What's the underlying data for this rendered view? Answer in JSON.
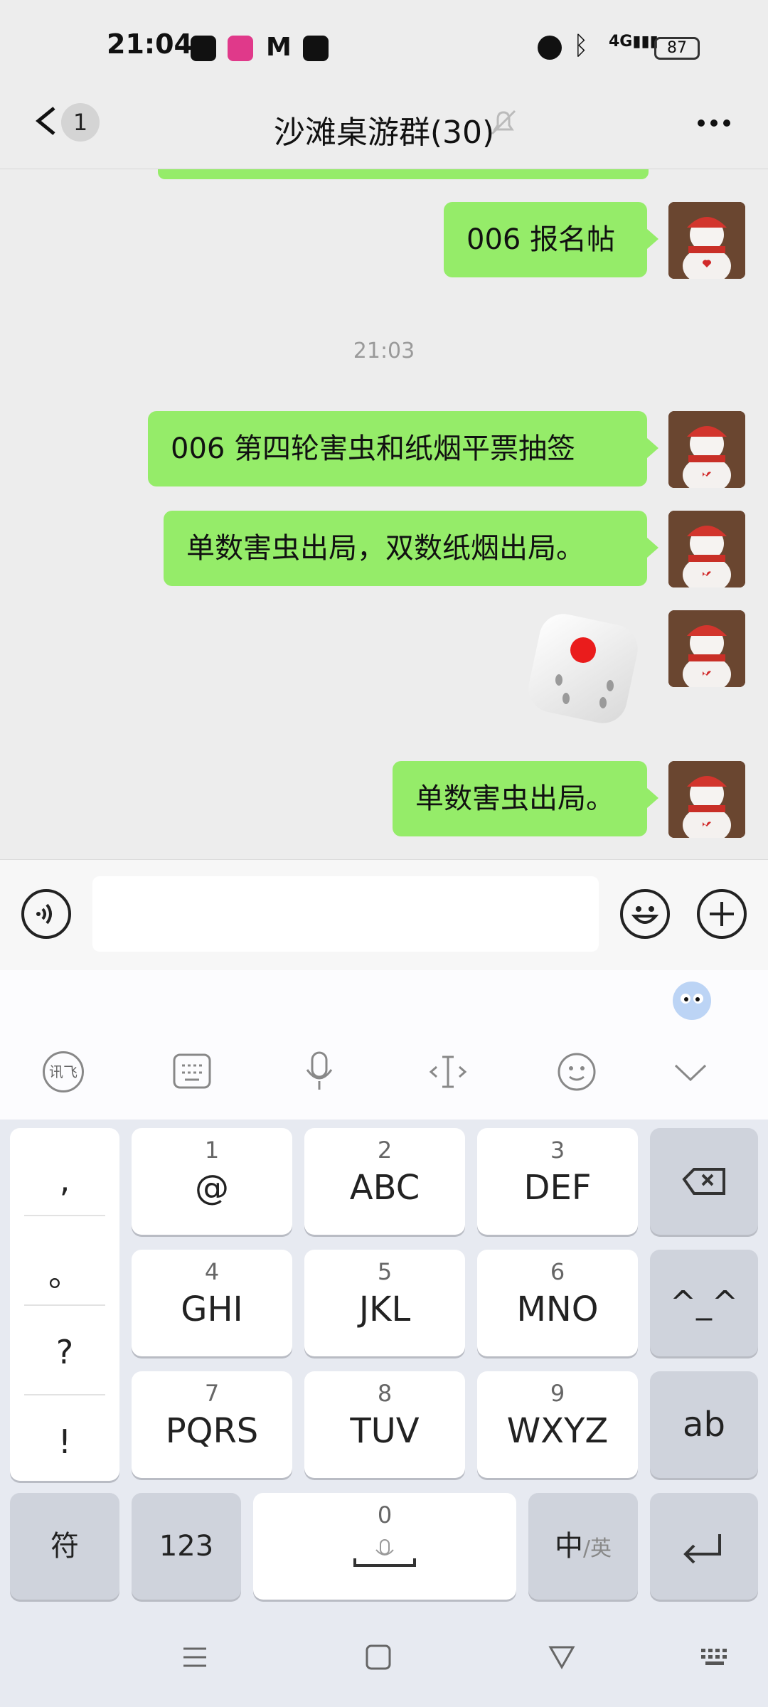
{
  "status_bar": {
    "time": "21:04",
    "battery": "87",
    "network": "4G"
  },
  "header": {
    "back_count": "1",
    "title": "沙滩桌游群(30)"
  },
  "chat": {
    "messages": [
      {
        "text": "006 报名帖"
      },
      {
        "text": "006 第四轮害虫和纸烟平票抽签"
      },
      {
        "text": "单数害虫出局，双数纸烟出局。"
      },
      {
        "text": "单数害虫出局。"
      }
    ],
    "timestamp": "21:03",
    "dice_value": 1
  },
  "input": {
    "value": "",
    "placeholder": ""
  },
  "keyboard": {
    "punctuation": [
      ",",
      "。",
      "?",
      "!"
    ],
    "keys": [
      {
        "num": "1",
        "label": "@"
      },
      {
        "num": "2",
        "label": "ABC"
      },
      {
        "num": "3",
        "label": "DEF"
      },
      {
        "num": "4",
        "label": "GHI"
      },
      {
        "num": "5",
        "label": "JKL"
      },
      {
        "num": "6",
        "label": "MNO"
      },
      {
        "num": "7",
        "label": "PQRS"
      },
      {
        "num": "8",
        "label": "TUV"
      },
      {
        "num": "9",
        "label": "WXYZ"
      }
    ],
    "emoticon": "^_^",
    "ab": "ab",
    "symbols": "符",
    "numbers": "123",
    "space_num": "0",
    "lang_main": "中",
    "lang_alt": "/英",
    "toolbar_logo_text": "讯飞"
  },
  "colors": {
    "bubble": "#95ec69",
    "background": "#ededed"
  }
}
